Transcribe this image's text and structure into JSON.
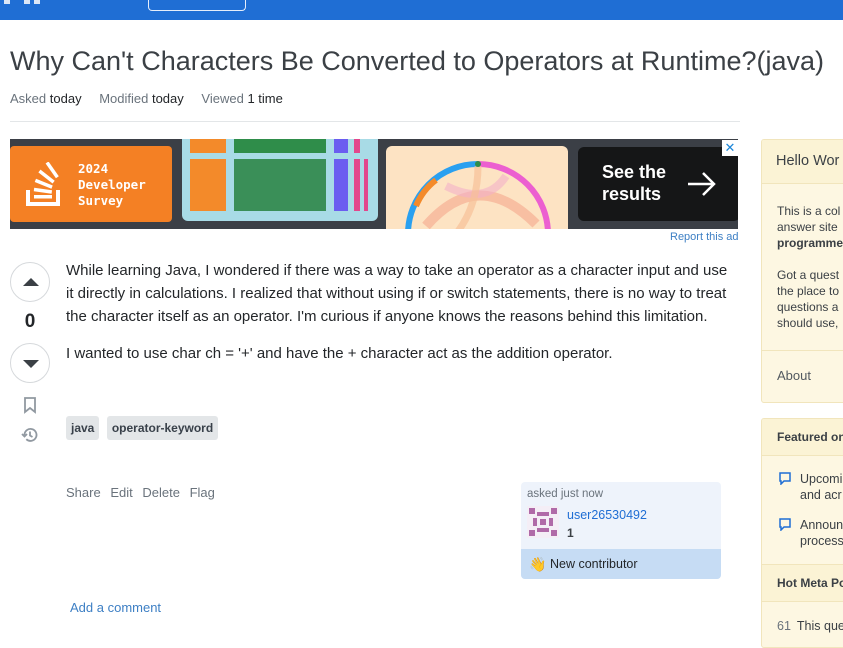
{
  "question": {
    "title": "Why Can't Characters Be Converted to Operators at Runtime?(java)",
    "meta": [
      {
        "label": "Asked",
        "value": "today"
      },
      {
        "label": "Modified",
        "value": "today"
      },
      {
        "label": "Viewed",
        "value": "1 time"
      }
    ],
    "votes": "0",
    "body": [
      "While learning Java, I wondered if there was a way to take an operator as a character input and use it directly in calculations. I realized that without using if or switch statements, there is no way to treat the character itself as an operator. I'm curious if anyone knows the reasons behind this limitation.",
      "I wanted to use char ch = '+' and have the + character act as the addition operator."
    ],
    "tags": [
      "java",
      "operator-keyword"
    ],
    "actions": [
      "Share",
      "Edit",
      "Delete",
      "Flag"
    ],
    "add_comment": "Add a comment"
  },
  "user_card": {
    "asked": "asked just now",
    "username": "user26530492",
    "reputation": "1",
    "new_contributor": "New contributor"
  },
  "ad": {
    "survey_text": "2024\nDeveloper\nSurvey",
    "cta": "See the\nresults",
    "close": "✕",
    "report": "Report this ad"
  },
  "sidebar": {
    "welcome_title": "Hello Wor",
    "welcome_lines": [
      "This is a col",
      "answer site",
      "programme",
      "",
      "Got a quest",
      "the place to",
      "questions a",
      "should use,"
    ],
    "about": "About",
    "featured_title": "Featured on",
    "featured_items": [
      {
        "line1": "Upcomi",
        "line2": "and acr"
      },
      {
        "line1": "Announ",
        "line2": "process"
      }
    ],
    "hot_meta_title": "Hot Meta Po",
    "hot_meta_items": [
      {
        "count": "61",
        "text": "This que"
      }
    ]
  },
  "colors": {
    "topbar": "#1f6ed4",
    "link": "#3d7fc4",
    "ad_orange": "#f48024",
    "new_contributor_bg": "#c6dcf4",
    "sidebar_bg": "#fdf7e2"
  }
}
